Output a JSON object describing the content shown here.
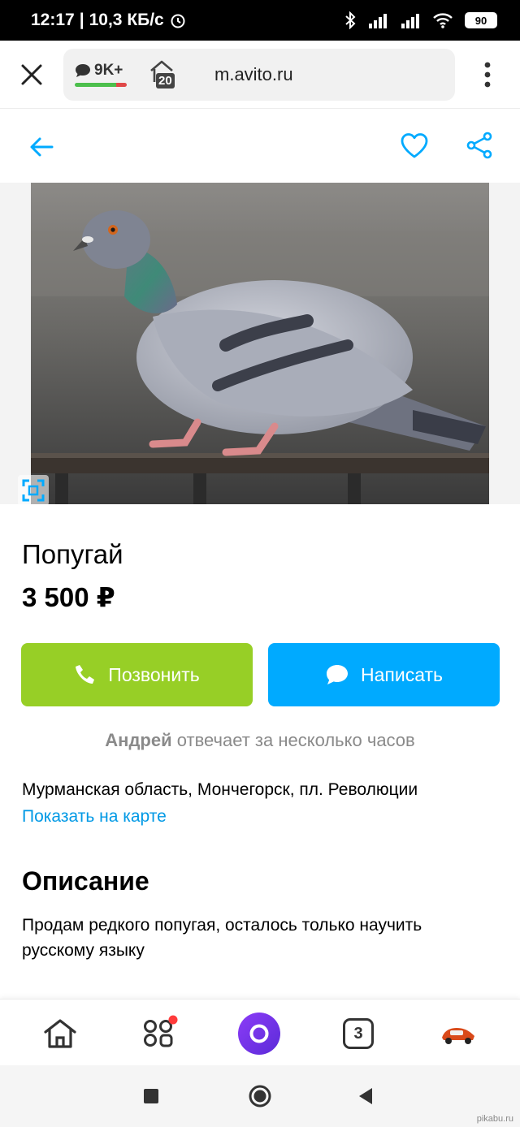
{
  "status_bar": {
    "time": "12:17",
    "net_speed": "10,3 КБ/с",
    "battery": "90"
  },
  "browser": {
    "messages_badge": "9K+",
    "tabs_count": "20",
    "url": "m.avito.ru"
  },
  "listing": {
    "title": "Попугай",
    "price": "3 500 ₽",
    "call_label": "Позвонить",
    "write_label": "Написать",
    "seller_name": "Андрей",
    "seller_response": "отвечает за несколько часов",
    "address": "Мурманская область, Мончегорск, пл. Революции",
    "map_link": "Показать на карте",
    "description_heading": "Описание",
    "description_text": "Продам редкого попугая, осталось только научить русскому языку"
  },
  "bottom_nav": {
    "tabs_count": "3"
  },
  "watermark": "pikabu.ru",
  "colors": {
    "call_button": "#97cf26",
    "write_button": "#00aaff",
    "link": "#0099e5",
    "icon_accent": "#00aaff"
  }
}
